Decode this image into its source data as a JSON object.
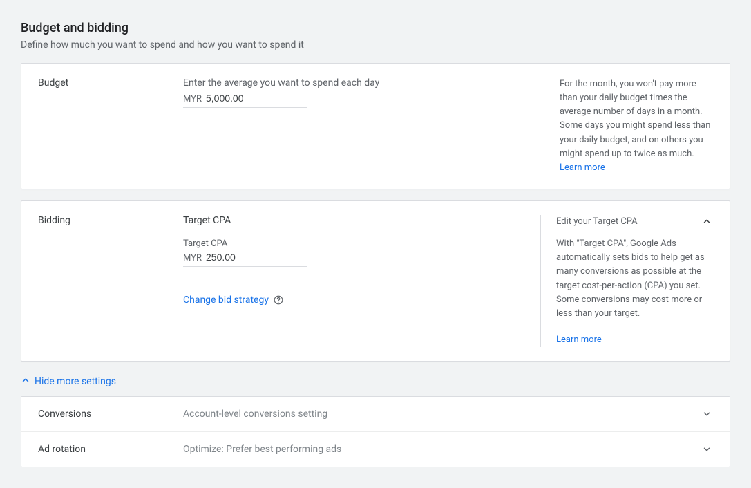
{
  "header": {
    "title": "Budget and bidding",
    "subtitle": "Define how much you want to spend and how you want to spend it"
  },
  "budget": {
    "label": "Budget",
    "hint": "Enter the average you want to spend each day",
    "currency": "MYR",
    "amount": "5,000.00",
    "side_text": "For the month, you won't pay more than your daily budget times the average number of days in a month. Some days you might spend less than your daily budget, and on others you might spend up to twice as much.",
    "learn_more": "Learn more"
  },
  "bidding": {
    "label": "Bidding",
    "strategy_name": "Target CPA",
    "field_label": "Target CPA",
    "currency": "MYR",
    "amount": "250.00",
    "change_link": "Change bid strategy",
    "side_header": "Edit your Target CPA",
    "side_text": "With \"Target CPA\", Google Ads automatically sets bids to help get as many conversions as possible at the target cost-per-action (CPA) you set. Some conversions may cost more or less than your target.",
    "learn_more": "Learn more"
  },
  "more_settings": {
    "toggle_label": "Hide more settings",
    "rows": [
      {
        "label": "Conversions",
        "value": "Account-level conversions setting"
      },
      {
        "label": "Ad rotation",
        "value": "Optimize: Prefer best performing ads"
      }
    ]
  }
}
